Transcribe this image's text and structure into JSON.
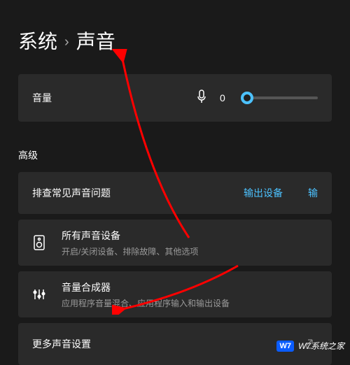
{
  "breadcrumb": {
    "parent": "系统",
    "current": "声音"
  },
  "volume": {
    "label": "音量",
    "value": "0"
  },
  "section_advanced": "高级",
  "troubleshoot": {
    "label": "排查常见声音问题",
    "output_link": "输出设备",
    "input_link": "输"
  },
  "all_devices": {
    "title": "所有声音设备",
    "subtitle": "开启/关闭设备、排除故障、其他选项"
  },
  "mixer": {
    "title": "音量合成器",
    "subtitle": "应用程序音量混合、应用程序输入和输出设备"
  },
  "more_settings": {
    "label": "更多声音设置"
  },
  "watermark": {
    "badge": "W7",
    "text": "W7系统之家"
  }
}
